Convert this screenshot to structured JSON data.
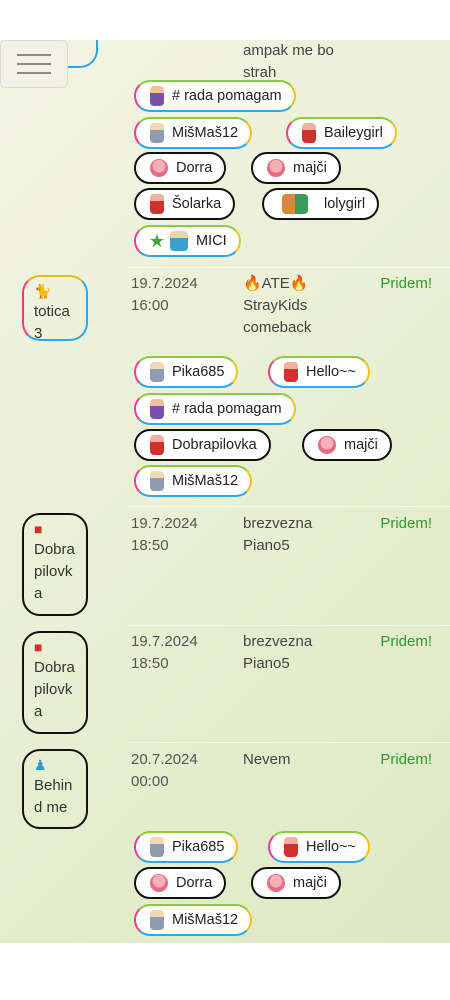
{
  "menu": {
    "icon": "hamburger-icon"
  },
  "top_partial": {
    "title_lines": [
      "ampak me bo",
      "strah"
    ]
  },
  "rows": [
    {
      "date_lines": [
        "19.7.2024",
        "16:00"
      ],
      "title_lines": [
        "🔥ATE🔥",
        "StrayKids",
        "comeback"
      ],
      "status": "Pridem!",
      "avatar": {
        "icon": "cat-icon",
        "name_lines": [
          "totica",
          "3"
        ]
      },
      "chips": [
        {
          "label": "Pika685",
          "icon": "girl-icon"
        },
        {
          "label": "Hello~~",
          "icon": "girl-icon"
        },
        {
          "label": "# rada pomagam",
          "icon": "dancer-icon"
        },
        {
          "label": "Dobrapilovka",
          "icon": "girl-icon"
        },
        {
          "label": "majči",
          "icon": "face-icon"
        },
        {
          "label": "MišMaš12",
          "icon": "girl-icon"
        }
      ]
    },
    {
      "date_lines": [
        "19.7.2024",
        "18:50"
      ],
      "title_lines": [
        "brezvezna",
        "Piano5"
      ],
      "status": "Pridem!",
      "avatar": {
        "icon": "girl-icon",
        "name_lines": [
          "Dobra",
          "pilovk",
          "a"
        ]
      }
    },
    {
      "date_lines": [
        "19.7.2024",
        "18:50"
      ],
      "title_lines": [
        "brezvezna",
        "Piano5"
      ],
      "status": "Pridem!",
      "avatar": {
        "icon": "girl-icon",
        "name_lines": [
          "Dobra",
          "pilovk",
          "a"
        ]
      }
    },
    {
      "date_lines": [
        "20.7.2024",
        "00:00"
      ],
      "title_lines": [
        "Nevem"
      ],
      "status": "Pridem!",
      "avatar": {
        "icon": "kids-icon",
        "name_lines": [
          "Behin",
          "d me"
        ]
      },
      "chips": [
        {
          "label": "Pika685",
          "icon": "girl-icon"
        },
        {
          "label": "Hello~~",
          "icon": "girl-icon"
        },
        {
          "label": "Dorra",
          "icon": "girl-icon"
        },
        {
          "label": "majči",
          "icon": "face-icon"
        },
        {
          "label": "MišMaš12",
          "icon": "girl-icon"
        }
      ]
    }
  ],
  "top_chips": [
    {
      "label": "# rada pomagam",
      "icon": "dancer-icon"
    },
    {
      "label": "MišMaš12",
      "icon": "girl-icon"
    },
    {
      "label": "Baileygirl",
      "icon": "girl-icon"
    },
    {
      "label": "Dorra",
      "icon": "girl-icon"
    },
    {
      "label": "majči",
      "icon": "face-icon"
    },
    {
      "label": "Šolarka",
      "icon": "girl-icon"
    },
    {
      "label": "lolygirl",
      "icon": "couple-icon"
    },
    {
      "label": "MICI",
      "icon": "star-icon"
    }
  ]
}
